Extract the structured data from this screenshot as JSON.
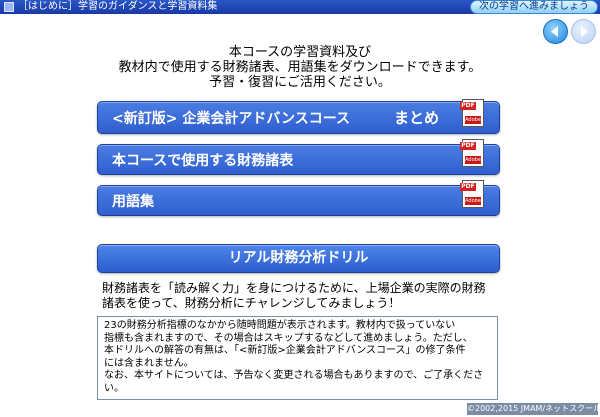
{
  "header": {
    "title": "［はじめに］学習のガイダンスと学習資料集",
    "next_label": "次の学習へ進みましょう"
  },
  "nav": {
    "back_icon": "back-arrow-icon",
    "forward_icon": "forward-arrow-icon"
  },
  "intro": {
    "lines": [
      "本コースの学習資料及び",
      "教材内で使用する財務諸表、用語集をダウンロードできます。",
      "予習・復習にご活用ください。"
    ]
  },
  "downloads": [
    {
      "label": "<新訂版> 企業会計アドバンスコース",
      "label2": "まとめ",
      "icon": "pdf-icon"
    },
    {
      "label": "本コースで使用する財務諸表",
      "icon": "pdf-icon"
    },
    {
      "label": "用語集",
      "icon": "pdf-icon"
    }
  ],
  "pdf_icon": {
    "tag": "PDF",
    "brand": "Adobe"
  },
  "drill": {
    "label": "リアル財務分析ドリル",
    "desc_lines": [
      "財務諸表を「読み解く力」を身につけるために、上場企業の実際の財務",
      "諸表を使って、財務分析にチャレンジしてみましょう！"
    ],
    "note_lines": [
      "23の財務分析指標のなかから随時問題が表示されます。教材内で扱っていない",
      "指標も含まれますので、その場合はスキップするなどして進めましょう。ただし、",
      "本ドリルへの解答の有無は、「<新訂版>企業会計アドバンスコース」の修了条件",
      "には含まれません。",
      "なお、本サイトについては、予告なく変更される場合もありますので、ご了承くださ",
      "い。"
    ]
  },
  "footer": {
    "copyright": "©2002,2015 JMAM/ネットスクール"
  },
  "colors": {
    "accent": "#2f5fcf",
    "topbar": "#1a3aa5"
  }
}
